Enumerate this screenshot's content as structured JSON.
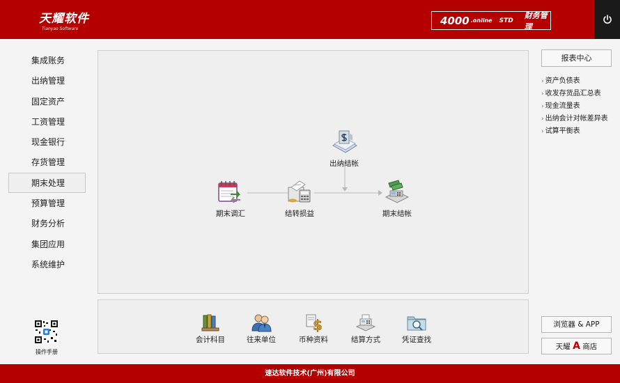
{
  "header": {
    "logo_cn": "天耀软件",
    "logo_en": "Tianyao Software",
    "product_number": "4000",
    "product_online": ".online",
    "product_edition": "STD",
    "product_name": "财务管理",
    "power_icon": "power-icon"
  },
  "nav": {
    "items": [
      {
        "label": "集成账务",
        "active": false
      },
      {
        "label": "出纳管理",
        "active": false
      },
      {
        "label": "固定资产",
        "active": false
      },
      {
        "label": "工资管理",
        "active": false
      },
      {
        "label": "现金银行",
        "active": false
      },
      {
        "label": "存货管理",
        "active": false
      },
      {
        "label": "期末处理",
        "active": true
      },
      {
        "label": "预算管理",
        "active": false
      },
      {
        "label": "财务分析",
        "active": false
      },
      {
        "label": "集团应用",
        "active": false
      },
      {
        "label": "系统维护",
        "active": false
      }
    ],
    "qr_label": "操作手册"
  },
  "flow": {
    "nodes": [
      {
        "label": "期末调汇",
        "icon": "calendar-transfer-icon"
      },
      {
        "label": "结转损益",
        "icon": "calculator-icon"
      },
      {
        "label": "出纳结帐",
        "icon": "cashier-cheque-icon"
      },
      {
        "label": "期末结帐",
        "icon": "cash-register-icon"
      }
    ]
  },
  "tools": {
    "items": [
      {
        "label": "会计科目",
        "icon": "account-books-icon"
      },
      {
        "label": "往来单位",
        "icon": "partners-icon"
      },
      {
        "label": "币种资料",
        "icon": "currency-icon"
      },
      {
        "label": "结算方式",
        "icon": "settlement-icon"
      },
      {
        "label": "凭证查找",
        "icon": "voucher-search-icon"
      }
    ]
  },
  "right": {
    "report_center": "报表中心",
    "report_links": [
      {
        "label": "资产负债表"
      },
      {
        "label": "收发存货品汇总表"
      },
      {
        "label": "现金流量表"
      },
      {
        "label": "出纳会计对帐差异表"
      },
      {
        "label": "试算平衡表"
      }
    ],
    "browser_app": "浏览器 & APP",
    "store_prefix": "天耀",
    "store_letter": "A",
    "store_suffix": "商店"
  },
  "footer": {
    "company": "速达软件技术(广州)有限公司"
  },
  "colors": {
    "brand_red": "#b50000",
    "power_bg": "#1a1a1a",
    "panel_bg": "#efefef"
  }
}
